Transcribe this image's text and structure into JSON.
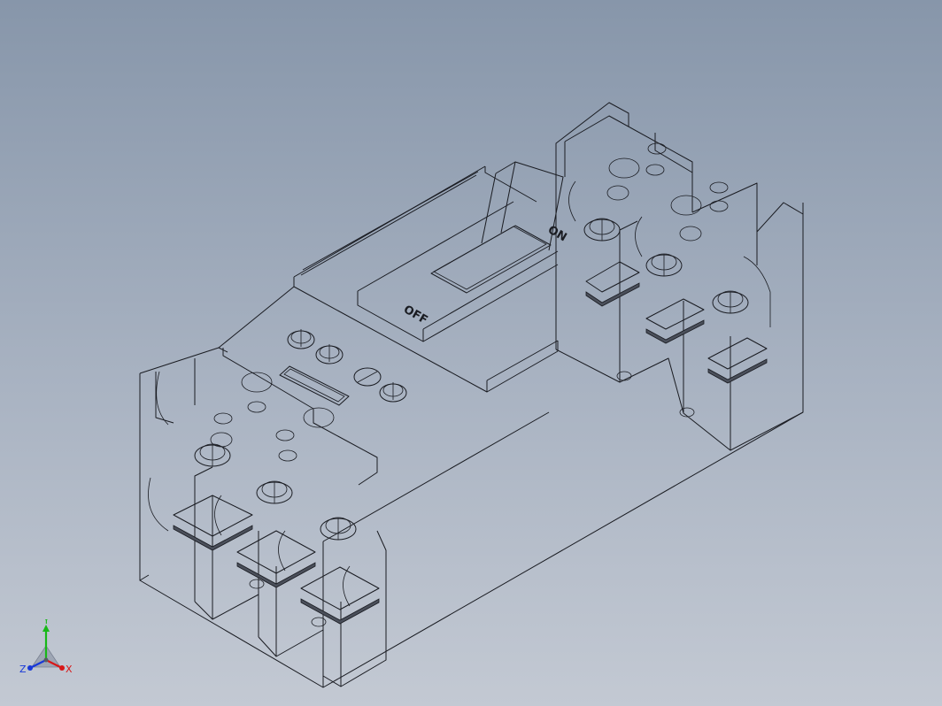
{
  "model": {
    "name": "circuit-breaker-3d-model",
    "switch_labels": {
      "on": "ON",
      "off": "OFF"
    }
  },
  "triad": {
    "x_label": "X",
    "y_label": "Y",
    "z_label": "Z",
    "colors": {
      "x": "#d81818",
      "y": "#18b818",
      "z": "#1838d8"
    }
  },
  "colors": {
    "background_top": "#8796aa",
    "background_bottom": "#c3c9d3",
    "edge": "#1a1c22"
  }
}
